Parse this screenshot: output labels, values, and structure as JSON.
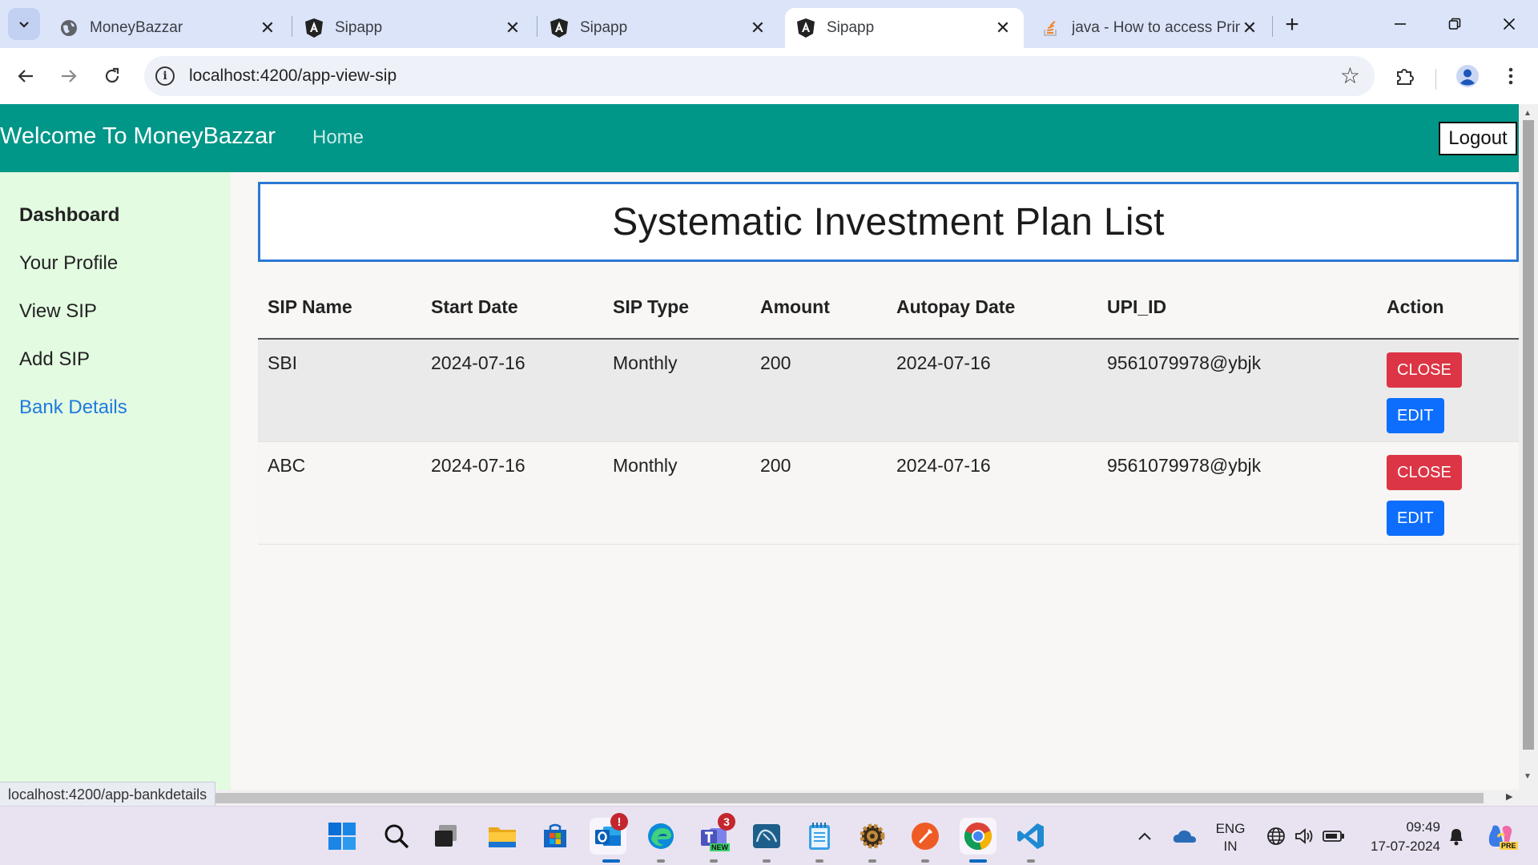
{
  "browser": {
    "tabs": [
      {
        "title": "MoneyBazzar",
        "icon": "globe-icon"
      },
      {
        "title": "Sipapp",
        "icon": "angular-icon"
      },
      {
        "title": "Sipapp",
        "icon": "angular-icon"
      },
      {
        "title": "Sipapp",
        "icon": "angular-icon",
        "active": true
      },
      {
        "title": "java - How to access Prin",
        "icon": "stackoverflow-icon"
      }
    ],
    "url": "localhost:4200/app-view-sip",
    "status_url": "localhost:4200/app-bankdetails"
  },
  "app": {
    "brand": "Welcome To MoneyBazzar",
    "home_label": "Home",
    "logout_label": "Logout",
    "accent_color": "#009688",
    "sidebar": {
      "items": [
        {
          "label": "Dashboard"
        },
        {
          "label": "Your Profile"
        },
        {
          "label": "View SIP"
        },
        {
          "label": "Add SIP"
        },
        {
          "label": "Bank Details"
        }
      ]
    },
    "page_title": "Systematic Investment Plan List",
    "table": {
      "headers": [
        "SIP Name",
        "Start Date",
        "SIP Type",
        "Amount",
        "Autopay Date",
        "UPI_ID",
        "Action"
      ],
      "rows": [
        {
          "name": "SBI",
          "start_date": "2024-07-16",
          "type": "Monthly",
          "amount": "200",
          "autopay_date": "2024-07-16",
          "upi_id": "9561079978@ybjk"
        },
        {
          "name": "ABC",
          "start_date": "2024-07-16",
          "type": "Monthly",
          "amount": "200",
          "autopay_date": "2024-07-16",
          "upi_id": "9561079978@ybjk"
        }
      ],
      "close_label": "CLOSE",
      "edit_label": "EDIT"
    }
  },
  "taskbar": {
    "outlook_badge": "!",
    "teams_badge": "3",
    "teams_new": "NEW",
    "lang_top": "ENG",
    "lang_bottom": "IN",
    "time": "09:49",
    "date": "17-07-2024",
    "copilot_label": "PRE"
  }
}
